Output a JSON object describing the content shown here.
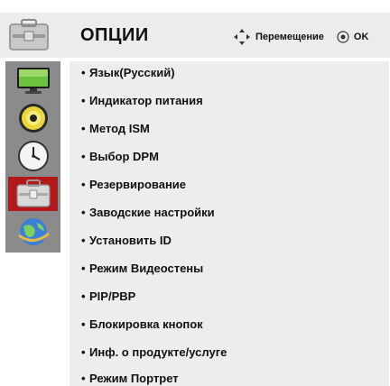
{
  "header": {
    "title": "ОПЦИИ",
    "move_hint": "Перемещение",
    "ok_hint": "OK"
  },
  "sidebar": {
    "items": [
      {
        "icon": "monitor-icon",
        "active": false
      },
      {
        "icon": "speaker-icon",
        "active": false
      },
      {
        "icon": "clock-icon",
        "active": false
      },
      {
        "icon": "toolbox-icon",
        "active": true
      },
      {
        "icon": "globe-icon",
        "active": false
      }
    ]
  },
  "menu": {
    "items": [
      "Язык(Русский)",
      "Индикатор питания",
      "Метод ISM",
      "Выбор DPM",
      "Резервирование",
      "Заводские настройки",
      "Установить ID",
      "Режим Видеостены",
      "PIP/PBP",
      "Блокировка кнопок",
      "Инф. о продукте/услуге",
      "Режим Портрет"
    ]
  },
  "colors": {
    "active_sidebar": "#b51818",
    "sidebar_bg": "#8b8b8b",
    "panel_bg": "#ededed"
  }
}
